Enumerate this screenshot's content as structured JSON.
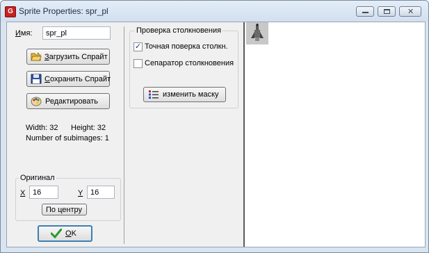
{
  "window": {
    "title": "Sprite Properties: spr_pl",
    "app_icon_glyph": "G",
    "min_glyph": "▁",
    "max_glyph": "□",
    "close_glyph": "✕"
  },
  "name": {
    "label_u": "И",
    "label_rest": "мя:",
    "value": "spr_pl"
  },
  "buttons": {
    "load_u": "З",
    "load_rest": "агрузить Спрайт",
    "save_u": "С",
    "save_rest": "охранить Спрайт",
    "edit_label": "Редактировать",
    "center_label": "По центру",
    "ok_u": "O",
    "ok_rest": "K",
    "mask_label": "изменить маску"
  },
  "info": {
    "width_text": "Width: 32",
    "height_text": "Height: 32",
    "subimages_text": "Number of subimages: 1"
  },
  "origin": {
    "title": "Оригинал",
    "x_label": "X",
    "x_value": "16",
    "y_label": "Y",
    "y_value": "16"
  },
  "collision": {
    "title": "Проверка столкновения",
    "precise_label": "Точная поверка столкн.",
    "precise_checked": true,
    "separate_label": "Сепаратор столкновения",
    "separate_checked": false,
    "check_glyph": "✓"
  },
  "icons": {
    "load": "folder-open-icon",
    "save": "floppy-disk-icon",
    "edit": "palette-icon",
    "ok": "checkmark-icon",
    "mask": "list-icon",
    "ok_color": "#2a9a2a"
  }
}
